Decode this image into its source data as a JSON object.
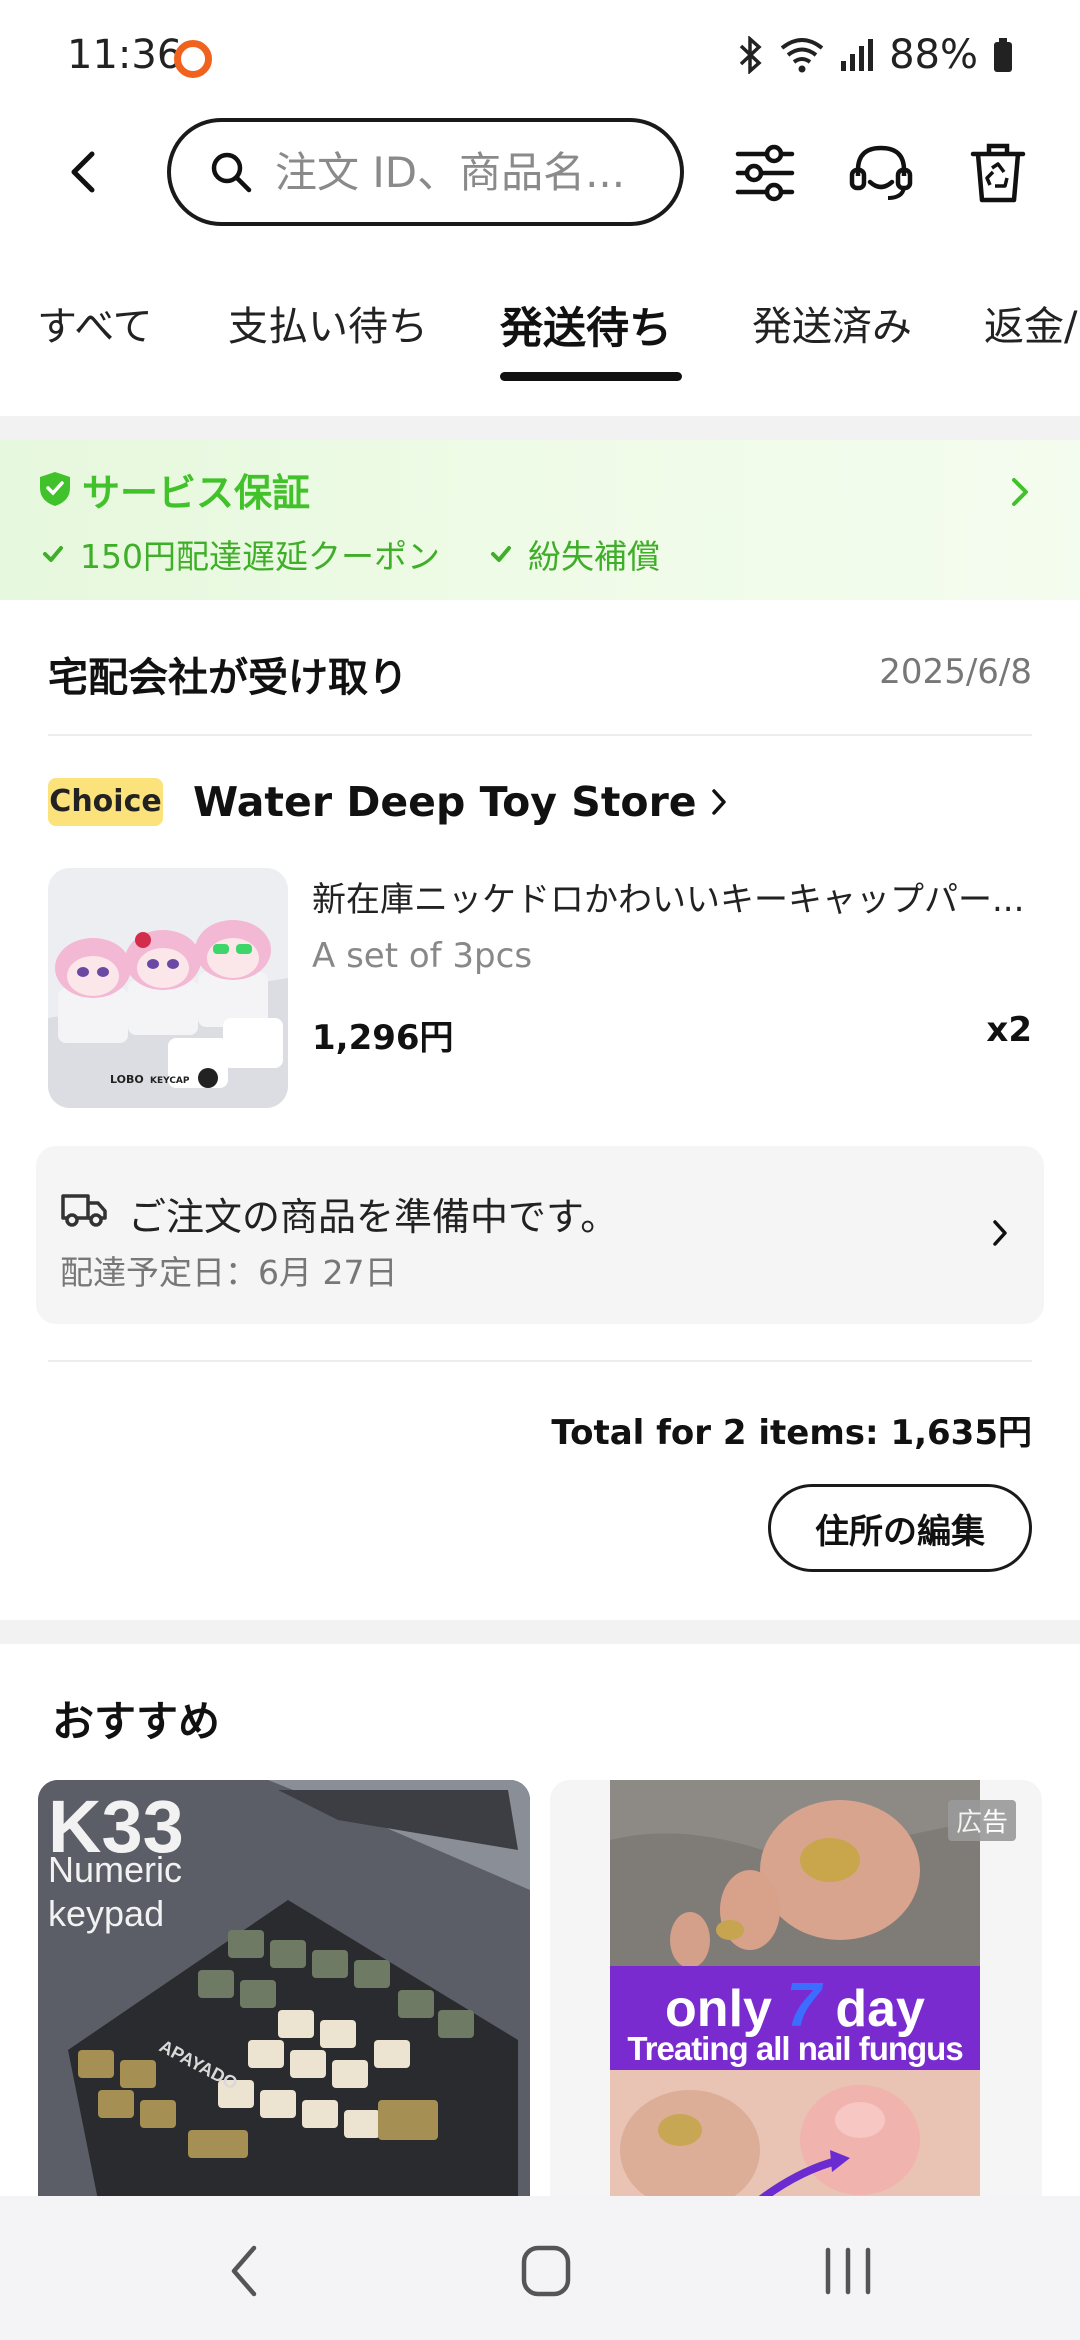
{
  "status_bar": {
    "time": "11:36",
    "battery": "88%"
  },
  "header": {
    "search_placeholder": "注文 ID、商品名..."
  },
  "tabs": [
    {
      "label": "すべて"
    },
    {
      "label": "支払い待ち"
    },
    {
      "label": "発送待ち",
      "active": true
    },
    {
      "label": "発送済み"
    },
    {
      "label": "返金/"
    }
  ],
  "service_banner": {
    "title": "サービス保証",
    "items": [
      "150円配達遅延クーポン",
      "紛失補償"
    ],
    "accent_color": "#42c22a"
  },
  "order": {
    "status": "宅配会社が受け取り",
    "date": "2025/6/8",
    "badge": "Choice",
    "store": "Water Deep Toy Store",
    "product": {
      "title": "新在庫ニッケドロかわいいキーキャップパー...",
      "variant": "A set of 3pcs",
      "price": "1,296円",
      "qty": "x2",
      "image_text": [
        "LOBO",
        "KEYCAP"
      ]
    },
    "delivery": {
      "message": "ご注文の商品を準備中です。",
      "eta": "配達予定日：6月 27日"
    },
    "total": "Total for 2 items: 1,635円",
    "edit_address": "住所の編集"
  },
  "recommendations": {
    "title": "おすすめ",
    "items": [
      {
        "headline": "K33",
        "subline": "Numeric keypad",
        "brand": "APAYADO"
      },
      {
        "ad_badge": "広告",
        "line1_pre": "only",
        "line1_num": "7",
        "line1_post": "day",
        "line2": "Treating all nail fungus"
      }
    ]
  }
}
